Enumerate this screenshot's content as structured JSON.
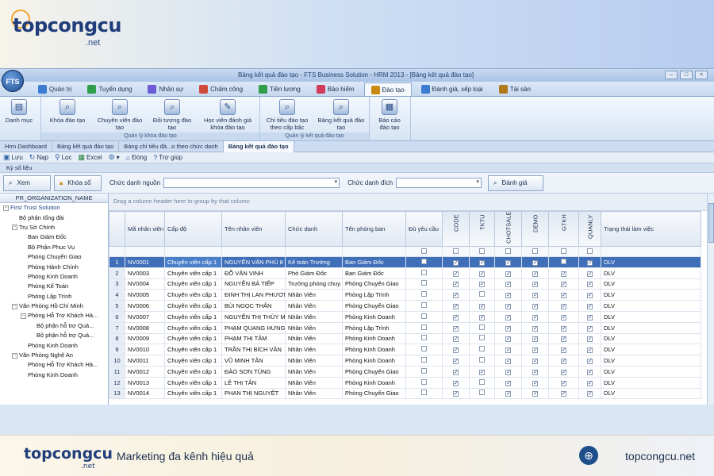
{
  "brand": {
    "name": "topcongcu",
    "net": ".net",
    "slogan": "Marketing đa kênh hiệu quả",
    "site": "topcongcu.net"
  },
  "window": {
    "caption": "Bảng kết quả đào tạo - FTS Business Solution - HRM 2013 - [Bảng kết quả đào tạo]",
    "orb": "FTS",
    "btns": [
      "–",
      "□",
      "×"
    ]
  },
  "tabs": [
    "Quản trị",
    "Tuyển dụng",
    "Nhân sự",
    "Chấm công",
    "Tiền lương",
    "Bảo hiểm",
    "Đào tạo",
    "Đánh giá, xếp loại",
    "Tài sản"
  ],
  "ribbon": {
    "danhmuc": "Danh mục",
    "g1": {
      "buttons": [
        "Khóa đào tạo",
        "Chuyên viên đào tạo",
        "Đối tượng đào tạo",
        "Học viên đánh giá khóa đào tạo"
      ],
      "label": "Quản lý khóa đào tạo"
    },
    "g2": {
      "buttons": [
        "Chỉ tiêu đào tạo theo cấp bậc",
        "Bảng kết quả đào tạo"
      ],
      "label": "Quản lý kết quả đào tạo"
    },
    "g3": {
      "buttons": [
        "Báo cáo đào tạo"
      ]
    }
  },
  "doctabs": [
    "Hrm Dashboard",
    "Bảng kết quả đào tạo",
    "Bảng chỉ tiêu đà...o theo chức danh",
    "Bảng kết quả đào tạo"
  ],
  "toolbar": [
    "Lưu",
    "Nạp",
    "Lọc",
    "Excel",
    "Đóng",
    "Trợ giúp"
  ],
  "section": "Kỳ số liệu",
  "filter": {
    "xem": "Xem",
    "khoaso": "Khóa sổ",
    "cdnguon": "Chức danh nguồn",
    "cddich": "Chức danh đích",
    "danhgia": "Đánh giá"
  },
  "tree": {
    "header": "PR_ORGANIZATION_NAME",
    "nodes": [
      {
        "t": "First Trust Solution",
        "d": 0,
        "tg": "−",
        "blue": true
      },
      {
        "t": "Bộ phận tổng đài",
        "d": 1
      },
      {
        "t": "Trụ Sở Chính",
        "d": 1,
        "tg": "−"
      },
      {
        "t": "Ban Giám Đốc",
        "d": 2
      },
      {
        "t": "Bộ Phận Phục Vụ",
        "d": 2
      },
      {
        "t": "Phòng Chuyển Giao",
        "d": 2
      },
      {
        "t": "Phòng Hành Chính",
        "d": 2
      },
      {
        "t": "Phòng Kinh Doanh",
        "d": 2
      },
      {
        "t": "Phòng Kế Toán",
        "d": 2
      },
      {
        "t": "Phòng Lập Trình",
        "d": 2
      },
      {
        "t": "Văn Phòng Hồ Chí Minh",
        "d": 1,
        "tg": "−"
      },
      {
        "t": "Phòng Hỗ Trợ Khách Hà...",
        "d": 2,
        "tg": "−"
      },
      {
        "t": "Bộ phận hỗ trợ Quả...",
        "d": 3
      },
      {
        "t": "Bộ phận hỗ trợ Quả...",
        "d": 3
      },
      {
        "t": "Phòng Kinh Doanh",
        "d": 2
      },
      {
        "t": "Văn Phòng Nghệ An",
        "d": 1,
        "tg": "−"
      },
      {
        "t": "Phòng Hỗ Trợ Khách Hà...",
        "d": 2
      },
      {
        "t": "Phòng Kinh Doanh",
        "d": 2
      }
    ]
  },
  "grid": {
    "hint": "Drag a column header here to group by that column",
    "columns": [
      "Mã nhân viên",
      "Cấp độ",
      "Tên nhân viên",
      "Chức danh",
      "Tên phòng ban",
      "Đủ yêu cầu",
      "CODE",
      "TKTU",
      "CHOTSALE",
      "DEMO",
      "GTKH",
      "QUANLY",
      "Trạng thái làm việc"
    ],
    "rows": [
      {
        "n": "1",
        "id": "NV0001",
        "lv": "Chuyên viên cấp 1",
        "name": "NGUYỄN VĂN PHÚ 8",
        "title": "Kế toán Trưởng",
        "dept": "Ban Giám Đốc",
        "ck": [
          0,
          1,
          1,
          1,
          1,
          0,
          1
        ],
        "st": "DLV"
      },
      {
        "n": "2",
        "id": "NV0003",
        "lv": "Chuyên viên cấp 1",
        "name": "ĐỖ VĂN VINH",
        "title": "Phó Giám Đốc",
        "dept": "Ban Giám Đốc",
        "ck": [
          0,
          1,
          1,
          1,
          1,
          1,
          1
        ],
        "st": "DLV"
      },
      {
        "n": "3",
        "id": "NV0004",
        "lv": "Chuyên viên cấp 1",
        "name": "NGUYỄN BÁ TIẾP",
        "title": "Trưởng phòng chuy...",
        "dept": "Phòng Chuyển Giao",
        "ck": [
          0,
          1,
          1,
          1,
          1,
          1,
          1
        ],
        "st": "DLV"
      },
      {
        "n": "4",
        "id": "NV0005",
        "lv": "Chuyên viên cấp 1",
        "name": "ĐINH THỊ LAN PHƯƠNG",
        "title": "Nhân Viên",
        "dept": "Phòng Lập Trình",
        "ck": [
          0,
          1,
          0,
          1,
          1,
          1,
          1
        ],
        "st": "DLV"
      },
      {
        "n": "5",
        "id": "NV0006",
        "lv": "Chuyên viên cấp 1",
        "name": "BÙI NGỌC THẮN",
        "title": "Nhân Viên",
        "dept": "Phòng Chuyển Giao",
        "ck": [
          0,
          1,
          1,
          1,
          1,
          1,
          1
        ],
        "st": "DLV"
      },
      {
        "n": "6",
        "id": "NV0007",
        "lv": "Chuyên viên cấp 1",
        "name": "NGUYỄN THỊ THÚY M...",
        "title": "Nhân Viên",
        "dept": "Phòng Kinh Doanh",
        "ck": [
          0,
          1,
          1,
          1,
          1,
          1,
          1
        ],
        "st": "DLV"
      },
      {
        "n": "7",
        "id": "NV0008",
        "lv": "Chuyên viên cấp 1",
        "name": "PHẠM QUANG HƯNG",
        "title": "Nhân Viên",
        "dept": "Phòng Lập Trình",
        "ck": [
          0,
          1,
          0,
          1,
          1,
          1,
          1
        ],
        "st": "DLV"
      },
      {
        "n": "8",
        "id": "NV0009",
        "lv": "Chuyên viên cấp 1",
        "name": "PHẠM THỊ TÂM",
        "title": "Nhân Viên",
        "dept": "Phòng Kinh Doanh",
        "ck": [
          0,
          1,
          0,
          1,
          1,
          1,
          1
        ],
        "st": "DLV"
      },
      {
        "n": "9",
        "id": "NV0010",
        "lv": "Chuyên viên cấp 1",
        "name": "TRẦN THỊ BÍCH VÂN",
        "title": "Nhân Viên",
        "dept": "Phòng Kinh Doanh",
        "ck": [
          0,
          1,
          0,
          1,
          1,
          1,
          1
        ],
        "st": "DLV"
      },
      {
        "n": "10",
        "id": "NV0011",
        "lv": "Chuyên viên cấp 1",
        "name": "VŨ MINH TÂN",
        "title": "Nhân Viên",
        "dept": "Phòng Kinh Doanh",
        "ck": [
          0,
          1,
          0,
          1,
          1,
          1,
          1
        ],
        "st": "DLV"
      },
      {
        "n": "11",
        "id": "NV0012",
        "lv": "Chuyên viên cấp 1",
        "name": "ĐÀO SƠN TÙNG",
        "title": "Nhân Viên",
        "dept": "Phòng Chuyển Giao",
        "ck": [
          0,
          1,
          1,
          1,
          1,
          1,
          1
        ],
        "st": "DLV"
      },
      {
        "n": "12",
        "id": "NV0013",
        "lv": "Chuyên viên cấp 1",
        "name": "LÊ THỊ TÂN",
        "title": "Nhân Viên",
        "dept": "Phòng Kinh Doanh",
        "ck": [
          0,
          1,
          0,
          1,
          1,
          1,
          1
        ],
        "st": "DLV"
      },
      {
        "n": "13",
        "id": "NV0014",
        "lv": "Chuyên viên cấp 1",
        "name": "PHAN THỊ NGUYỆT",
        "title": "Nhân Viên",
        "dept": "Phòng Chuyển Giao",
        "ck": [
          0,
          1,
          0,
          1,
          1,
          1,
          1
        ],
        "st": "DLV"
      }
    ]
  }
}
